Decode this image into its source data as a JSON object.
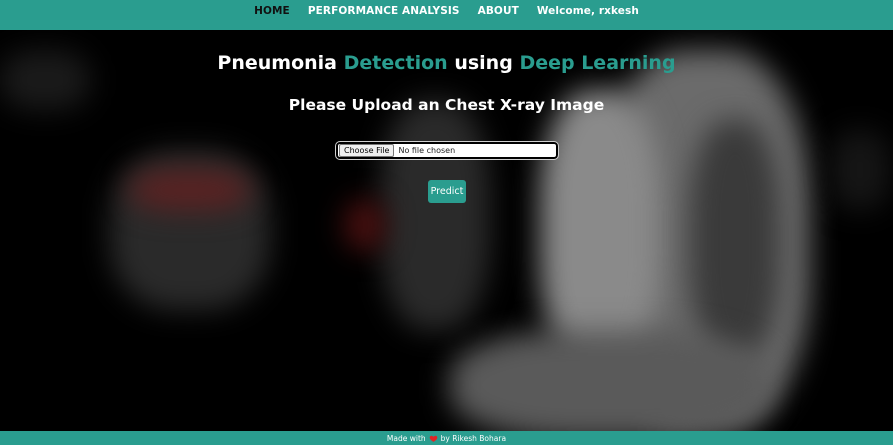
{
  "nav": {
    "items": [
      {
        "label": "HOME",
        "active": true
      },
      {
        "label": "PERFORMANCE ANALYSIS",
        "active": false
      },
      {
        "label": "ABOUT",
        "active": false
      },
      {
        "label": "Welcome, rxkesh",
        "active": false
      }
    ]
  },
  "main": {
    "title": {
      "part1": "Pneumonia",
      "part2": "Detection",
      "part3": "using",
      "part4": "Deep Learning"
    },
    "subtitle": "Please Upload an Chest X-ray Image",
    "file_input": {
      "button_label": "Choose File",
      "status": "No file chosen"
    },
    "predict_label": "Predict"
  },
  "footer": {
    "prefix": "Made with",
    "icon": "heart-icon",
    "suffix": "by Rikesh Bohara"
  },
  "colors": {
    "accent": "#2a9d8f",
    "background": "#000000",
    "heart": "#e02424"
  }
}
